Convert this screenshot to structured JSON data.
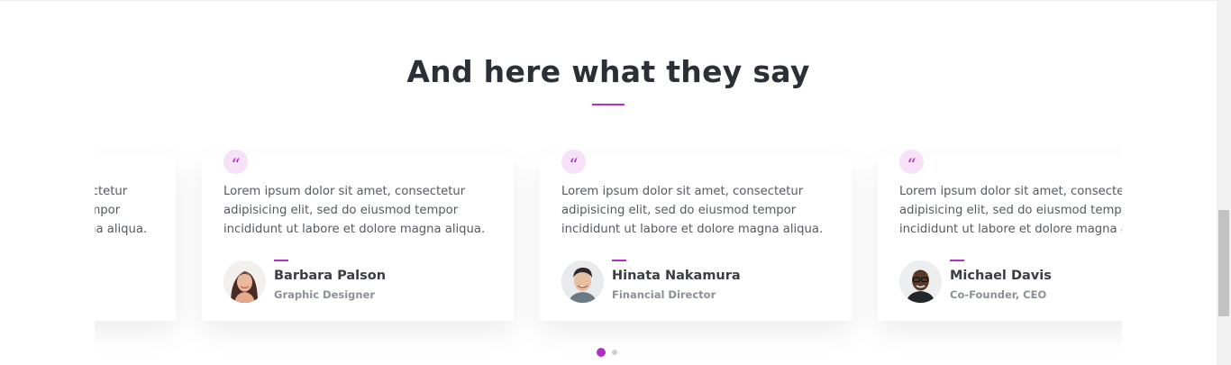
{
  "section": {
    "title": "And here what they say"
  },
  "testimonials": [
    {
      "text": "Lorem ipsum dolor sit amet, consectetur adipisicing elit, sed do eiusmod tempor incididunt ut labore et dolore magna aliqua.",
      "name": "",
      "role": ""
    },
    {
      "text": "Lorem ipsum dolor sit amet, consectetur adipisicing elit, sed do eiusmod tempor incididunt ut labore et dolore magna aliqua.",
      "name": "Barbara Palson",
      "role": "Graphic Designer"
    },
    {
      "text": "Lorem ipsum dolor sit amet, consectetur adipisicing elit, sed do eiusmod tempor incididunt ut labore et dolore magna aliqua.",
      "name": "Hinata Nakamura",
      "role": "Financial Director"
    },
    {
      "text": "Lorem ipsum dolor sit amet, consectetur adipisicing elit, sed do eiusmod tempor incididunt ut labore et dolore magna aliqua.",
      "name": "Michael Davis",
      "role": "Co-Founder, CEO"
    }
  ],
  "quote_glyph": "“",
  "pagination": {
    "total": 2,
    "active": 1
  },
  "colors": {
    "accent": "#b02fc4",
    "heading": "#2c3036",
    "body_text": "#555a60",
    "role_text": "#8c9096"
  }
}
